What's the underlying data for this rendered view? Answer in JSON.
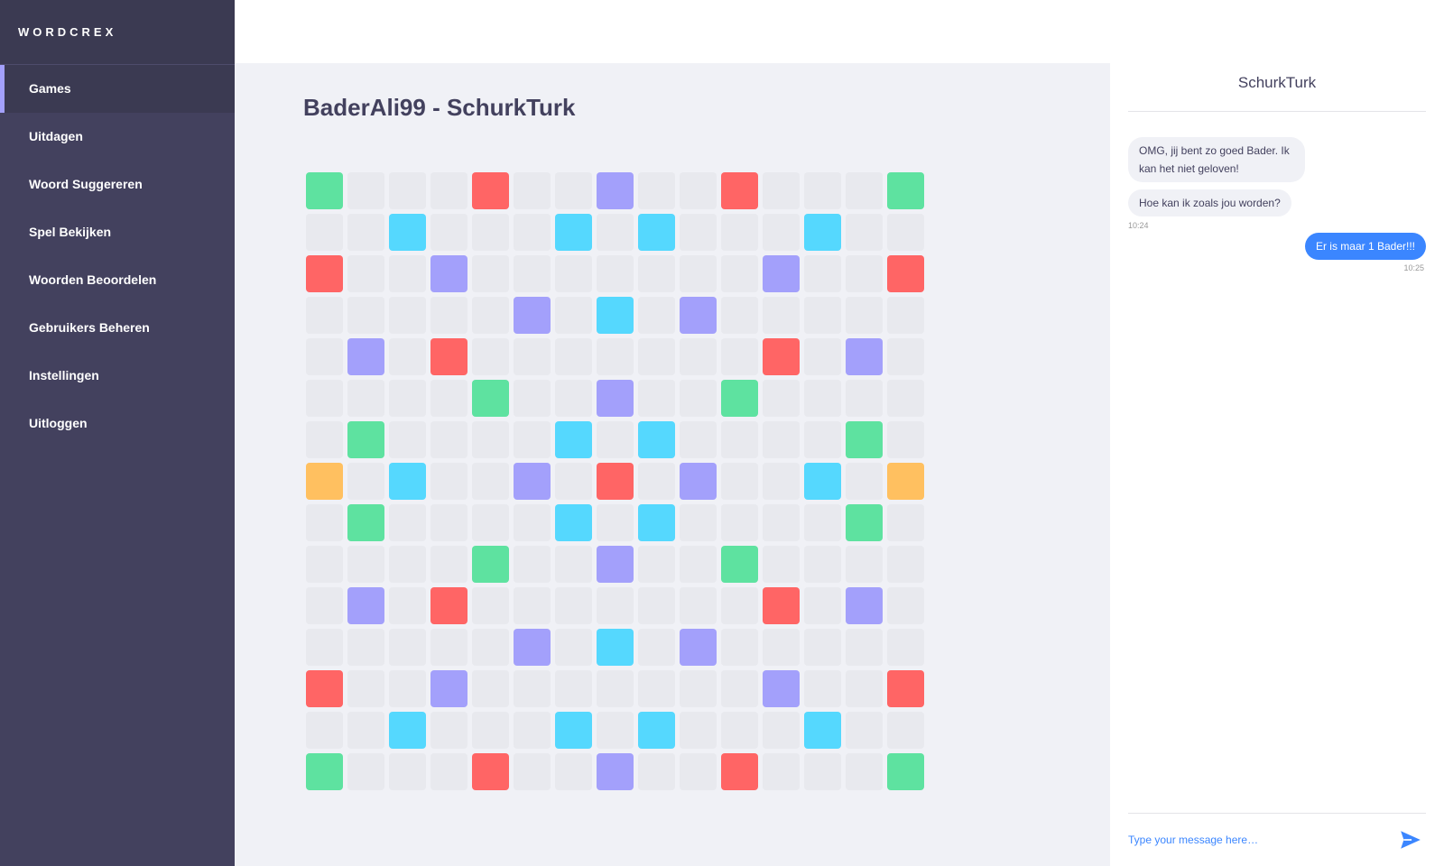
{
  "app": {
    "logo": "WORDCREX"
  },
  "sidebar": {
    "items": [
      {
        "label": "Games",
        "active": true
      },
      {
        "label": "Uitdagen"
      },
      {
        "label": "Woord Suggereren"
      },
      {
        "label": "Spel Bekijken"
      },
      {
        "label": "Woorden Beoordelen"
      },
      {
        "label": "Gebruikers Beheren"
      },
      {
        "label": "Instellingen"
      },
      {
        "label": "Uitloggen"
      }
    ]
  },
  "game": {
    "title": "BaderAli99 - SchurkTurk",
    "board": [
      "G...R..P..R...G",
      "..C...C.C...C..",
      "R..P.......P..R",
      ".....P.C.P.....",
      ".P.R.......R.P.",
      "....G..P..G....",
      ".G....C.C....G.",
      "O.C..P.R.P..C.O",
      ".G....C.C....G.",
      "....G..P..G....",
      ".P.R.......R.P.",
      ".....P.C.P.....",
      "R..P.......P..R",
      "..C...C.C...C..",
      "G...R..P..R...G"
    ],
    "colors": {
      ".": "#e8e9ee",
      "G": "#5ee2a0",
      "R": "#ff6565",
      "P": "#a3a0fb",
      "C": "#55d8fe",
      "O": "#ffc060"
    }
  },
  "chat": {
    "contact": "SchurkTurk",
    "messages": [
      {
        "from": "them",
        "text": "OMG, jij bent zo goed Bader. Ik kan het niet geloven!"
      },
      {
        "from": "them",
        "text": "Hoe kan ik zoals jou worden?",
        "time": "10:24"
      },
      {
        "from": "me",
        "text": "Er is maar 1 Bader!!!",
        "time": "10:25"
      }
    ],
    "input_placeholder": "Type your message here…",
    "send_icon": "send-icon",
    "accent_color": "#3b86ff"
  }
}
